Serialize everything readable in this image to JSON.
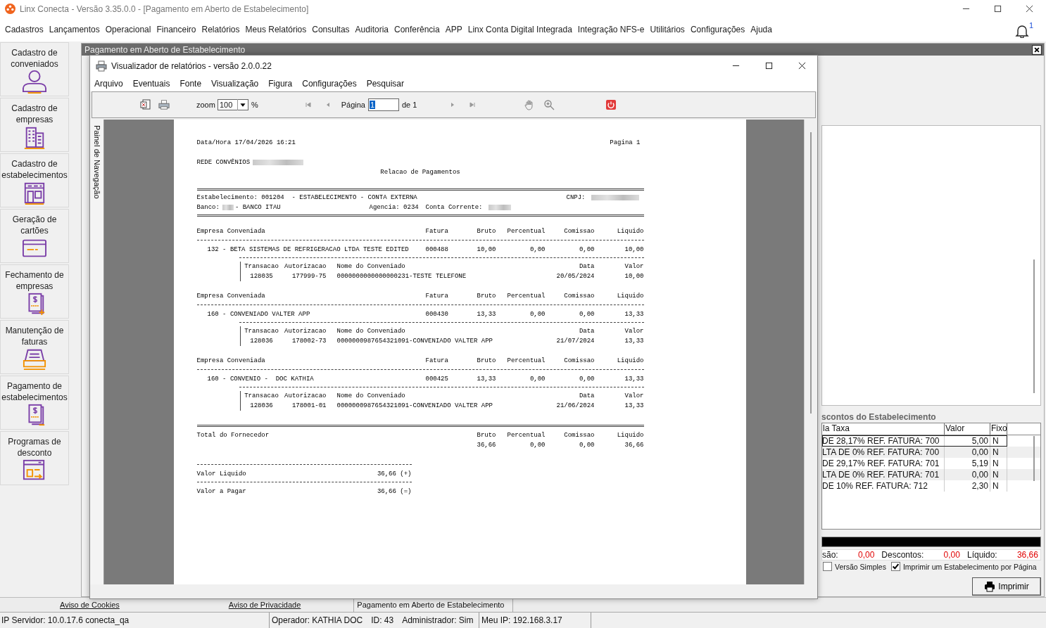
{
  "app": {
    "title": "Linx Conecta - Versão 3.35.0.0 - [Pagamento em Aberto de Estabelecimento]",
    "menu": [
      "Cadastros",
      "Lançamentos",
      "Operacional",
      "Financeiro",
      "Relatórios",
      "Meus Relatórios",
      "Consultas",
      "Auditoria",
      "Conferência",
      "APP",
      "Linx Conta Digital Integrada",
      "Integração NFS-e",
      "Utilitários",
      "Configurações",
      "Ajuda"
    ],
    "notification_count": "1"
  },
  "sidebar": {
    "items": [
      {
        "label": "Cadastro de conveniados"
      },
      {
        "label": "Cadastro de empresas"
      },
      {
        "label": "Cadastro de estabelecimentos"
      },
      {
        "label": "Geração de cartões"
      },
      {
        "label": "Fechamento de empresas"
      },
      {
        "label": "Manutenção de faturas"
      },
      {
        "label": "Pagamento de estabelecimentos"
      },
      {
        "label": "Programas de desconto"
      }
    ]
  },
  "child_window": {
    "title": "Pagamento em Aberto de Estabelecimento",
    "discounts": {
      "label": "scontos do Estabelecimento",
      "columns": [
        "la Taxa",
        "Valor",
        "Fixo"
      ],
      "rows": [
        {
          "description": "DE 28,17% REF. FATURA: 700",
          "value": "5,00",
          "fixed": "N",
          "selected": true
        },
        {
          "description": "LTA DE 0% REF. FATURA: 700",
          "value": "0,00",
          "fixed": "N",
          "selected": false
        },
        {
          "description": "DE 29,17% REF. FATURA: 701",
          "value": "5,19",
          "fixed": "N",
          "selected": false
        },
        {
          "description": "LTA DE 0% REF. FATURA: 701",
          "value": "0,00",
          "fixed": "N",
          "selected": false
        },
        {
          "description": "DE 10% REF. FATURA: 712",
          "value": "2,30",
          "fixed": "N",
          "selected": false
        }
      ]
    },
    "progress": {
      "level": 1
    },
    "totals": [
      {
        "label": "são:",
        "value": "0,00"
      },
      {
        "label": "Descontos:",
        "value": "0,00"
      },
      {
        "label": "Líquido:",
        "value": "36,66"
      }
    ],
    "options": [
      {
        "label": "Versão Simples",
        "checked": false
      },
      {
        "label": "Imprimir um Estabelecimento por Página",
        "checked": true
      }
    ],
    "print_button": "Imprimir"
  },
  "viewer": {
    "title": "Visualizador de relatórios - versão 2.0.0.22",
    "menu": [
      "Arquivo",
      "Eventuais",
      "Fonte",
      "Visualização",
      "Figura",
      "Configurações",
      "Pesquisar"
    ],
    "toolbar": {
      "zoom_label": "zoom",
      "zoom_value": "100",
      "percent": "%",
      "page_label": "Página",
      "page_value": "1",
      "page_of": "de 1"
    },
    "side_tab": "Painel de Navegação",
    "report": {
      "datetime": "Data/Hora 17/04/2026 16:21",
      "page": "Pagina 1",
      "network": "REDE CONVÊNIOS",
      "title": "Relacao de Pagamentos",
      "establishment": "Estabelecimento: 001204  - ESTABELECIMENTO - CONTA EXTERNA",
      "cnpj_label": "CNPJ:",
      "bank_label": "Banco:",
      "bank_name": "- BANCO ITAU",
      "agency": "Agencia: 0234",
      "account_label": "Conta Corrente:",
      "groups": [
        {
          "columns": [
            "Empresa Conveniada",
            "Fatura",
            "Bruto",
            "Percentual",
            "Comissao",
            "Liquido"
          ],
          "transaction_columns": [
            "Transacao",
            "Autorizacao",
            "Nome do Conveniado",
            "Data",
            "Valor"
          ],
          "company": [
            "132 - BETA SISTEMAS DE REFRIGERACAO LTDA TESTE EDITED",
            "000488",
            "10,00",
            "0,00",
            "0,00",
            "10,00"
          ],
          "transactions": [
            [
              "128035",
              "177999-75",
              "0000000000000000231-TESTE TELEFONE",
              "20/05/2024",
              "10,00"
            ]
          ]
        },
        {
          "columns": [
            "Empresa Conveniada",
            "Fatura",
            "Bruto",
            "Percentual",
            "Comissao",
            "Liquido"
          ],
          "transaction_columns": [
            "Transacao",
            "Autorizacao",
            "Nome do Conveniado",
            "Data",
            "Valor"
          ],
          "company": [
            "160 - CONVENIADO VALTER APP",
            "000430",
            "13,33",
            "0,00",
            "0,00",
            "13,33"
          ],
          "transactions": [
            [
              "128036",
              "178002-73",
              "0000000987654321091-CONVENIADO VALTER APP",
              "21/07/2024",
              "13,33"
            ]
          ]
        },
        {
          "columns": [
            "Empresa Conveniada",
            "Fatura",
            "Bruto",
            "Percentual",
            "Comissao",
            "Liquido"
          ],
          "transaction_columns": [
            "Transacao",
            "Autorizacao",
            "Nome do Conveniado",
            "Data",
            "Valor"
          ],
          "company": [
            "160 - CONVENIO -  DOC KATHIA",
            "000425",
            "13,33",
            "0,00",
            "0,00",
            "13,33"
          ],
          "transactions": [
            [
              "128036",
              "178001-01",
              "0000000987654321091-CONVENIADO VALTER APP",
              "21/06/2024",
              "13,33"
            ]
          ]
        }
      ],
      "total": {
        "label": "Total do Fornecedor",
        "columns": [
          "Bruto",
          "Percentual",
          "Comissao",
          "Liquido"
        ],
        "values": [
          "36,66",
          "0,00",
          "0,00",
          "36,66"
        ]
      },
      "summary": [
        {
          "label": "Valor Liquido",
          "value": "36,66 (+)"
        },
        {
          "label": "Valor a Pagar",
          "value": "36,66 (=)"
        }
      ]
    }
  },
  "footer": {
    "links": [
      "Aviso de Cookies",
      "Aviso de Privacidade"
    ],
    "tab": "Pagamento em Aberto de Estabelecimento"
  },
  "status_bar": {
    "server": "IP Servidor: 10.0.17.6 conecta_qa",
    "operator": "Operador: KATHIA DOC",
    "id": "ID: 43",
    "admin": "Administrador: Sim",
    "ip": "Meu IP: 192.168.3.17"
  }
}
